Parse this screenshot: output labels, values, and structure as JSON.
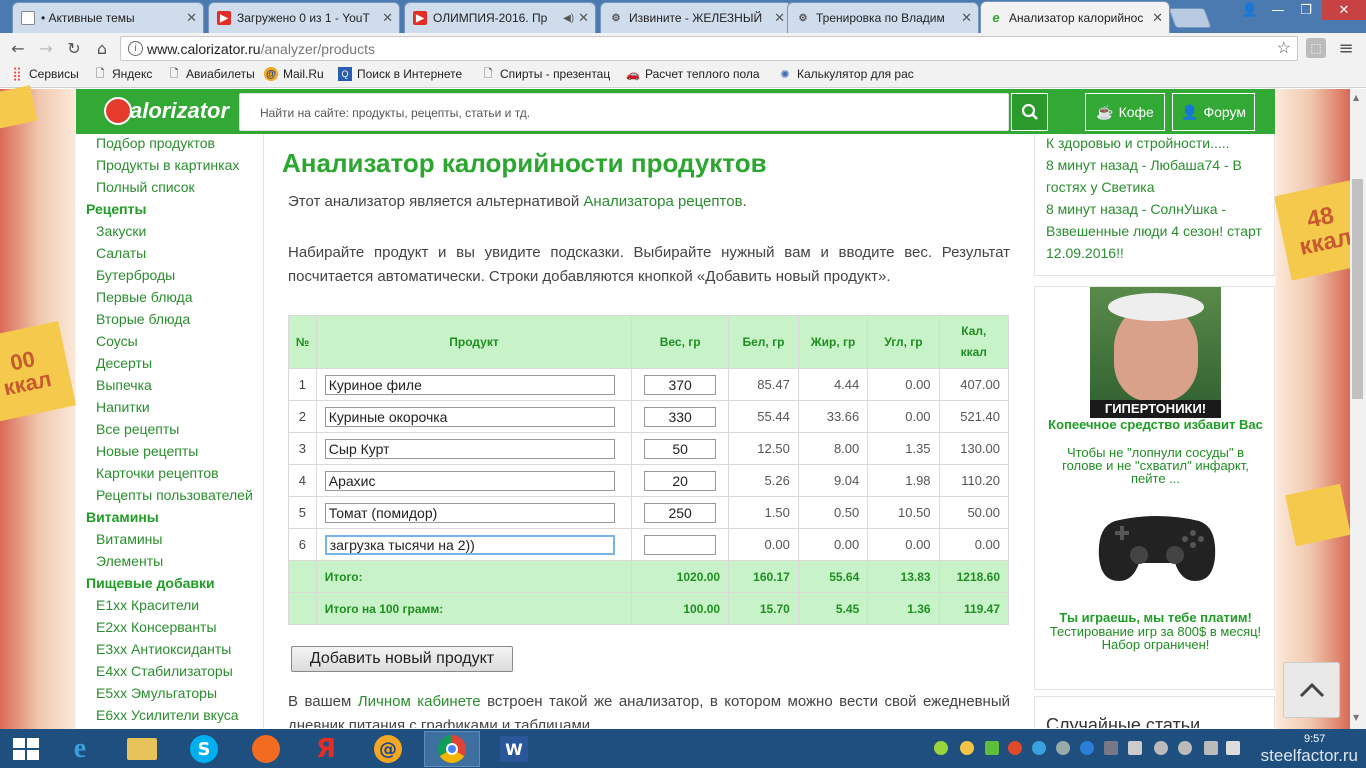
{
  "browser": {
    "tabs": [
      {
        "title": "• Активные темы",
        "icon": "doc-icon",
        "color": "#ffffff"
      },
      {
        "title": "Загружено 0 из 1 - YouT",
        "icon": "youtube-icon",
        "color": "#e52d27"
      },
      {
        "title": "ОЛИМПИЯ-2016. Пр",
        "icon": "youtube-icon",
        "color": "#e52d27"
      },
      {
        "title": "Извините - ЖЕЛЕЗНЫЙ",
        "icon": "barbell-icon",
        "color": "#555555"
      },
      {
        "title": "Тренировка по Владим",
        "icon": "barbell-icon",
        "color": "#555555"
      },
      {
        "title": "Анализатор калорийнос",
        "icon": "calorizator-icon",
        "color": "#2ba62f"
      }
    ],
    "url_domain": "www.calorizator.ru",
    "url_path": "/analyzer/products",
    "bookmarks": [
      {
        "label": "Сервисы",
        "icon": "apps-icon"
      },
      {
        "label": "Яндекс",
        "icon": "doc-icon"
      },
      {
        "label": "Авиабилеты",
        "icon": "doc-icon"
      },
      {
        "label": "Mail.Ru",
        "icon": "mailru-icon"
      },
      {
        "label": "Поиск в Интернете",
        "icon": "search-icon"
      },
      {
        "label": "Спирты - презентац",
        "icon": "doc-icon"
      },
      {
        "label": "Расчет теплого пола",
        "icon": "car-icon"
      },
      {
        "label": "Калькулятор для рас",
        "icon": "gear-icon"
      }
    ]
  },
  "site": {
    "logo_text": "alorizator",
    "search_placeholder": "Найти на сайте: продукты, рецепты, статьи и тд.",
    "coffee_label": "Кофе",
    "forum_label": "Форум"
  },
  "nav": [
    {
      "label": "Подбор продуктов",
      "header": false
    },
    {
      "label": "Продукты в картинках",
      "header": false
    },
    {
      "label": "Полный список",
      "header": false
    },
    {
      "label": "Рецепты",
      "header": true
    },
    {
      "label": "Закуски",
      "header": false
    },
    {
      "label": "Салаты",
      "header": false
    },
    {
      "label": "Бутерброды",
      "header": false
    },
    {
      "label": "Первые блюда",
      "header": false
    },
    {
      "label": "Вторые блюда",
      "header": false
    },
    {
      "label": "Соусы",
      "header": false
    },
    {
      "label": "Десерты",
      "header": false
    },
    {
      "label": "Выпечка",
      "header": false
    },
    {
      "label": "Напитки",
      "header": false
    },
    {
      "label": "Все рецепты",
      "header": false
    },
    {
      "label": "Новые рецепты",
      "header": false
    },
    {
      "label": "Карточки рецептов",
      "header": false
    },
    {
      "label": "Рецепты пользователей",
      "header": false
    },
    {
      "label": "Витамины",
      "header": true
    },
    {
      "label": "Витамины",
      "header": false
    },
    {
      "label": "Элементы",
      "header": false
    },
    {
      "label": "Пищевые добавки",
      "header": true
    },
    {
      "label": "E1xx Красители",
      "header": false
    },
    {
      "label": "E2xx Консерванты",
      "header": false
    },
    {
      "label": "E3xx Антиоксиданты",
      "header": false
    },
    {
      "label": "E4xx Стабилизаторы",
      "header": false
    },
    {
      "label": "E5xx Эмульгаторы",
      "header": false
    },
    {
      "label": "E6xx Усилители вкуса",
      "header": false
    }
  ],
  "main": {
    "title": "Анализатор калорийности продуктов",
    "intro_before": "Этот анализатор является альтернативой ",
    "intro_link": "Анализатора рецептов",
    "intro_after": ".",
    "instructions": "Набирайте продукт и вы увидите подсказки. Выбирайте нужный вам и вводите вес. Результат посчитается автоматически. Строки добавляются кнопкой «Добавить новый продукт».",
    "table": {
      "headers": [
        "№",
        "Продукт",
        "Вес, гр",
        "Бел, гр",
        "Жир, гр",
        "Угл, гр",
        "Кал, ккал"
      ],
      "rows": [
        {
          "n": "1",
          "product": "Куриное филе",
          "weight": "370",
          "protein": "85.47",
          "fat": "4.44",
          "carbs": "0.00",
          "kcal": "407.00"
        },
        {
          "n": "2",
          "product": "Куриные окорочка",
          "weight": "330",
          "protein": "55.44",
          "fat": "33.66",
          "carbs": "0.00",
          "kcal": "521.40"
        },
        {
          "n": "3",
          "product": "Сыр Курт",
          "weight": "50",
          "protein": "12.50",
          "fat": "8.00",
          "carbs": "1.35",
          "kcal": "130.00"
        },
        {
          "n": "4",
          "product": "Арахис",
          "weight": "20",
          "protein": "5.26",
          "fat": "9.04",
          "carbs": "1.98",
          "kcal": "110.20"
        },
        {
          "n": "5",
          "product": "Томат (помидор)",
          "weight": "250",
          "protein": "1.50",
          "fat": "0.50",
          "carbs": "10.50",
          "kcal": "50.00"
        },
        {
          "n": "6",
          "product": "загрузка тысячи на 2))",
          "weight": "",
          "protein": "0.00",
          "fat": "0.00",
          "carbs": "0.00",
          "kcal": "0.00"
        }
      ],
      "total": {
        "label": "Итого:",
        "weight": "1020.00",
        "protein": "160.17",
        "fat": "55.64",
        "carbs": "13.83",
        "kcal": "1218.60"
      },
      "per100": {
        "label": "Итого на 100 грамм:",
        "weight": "100.00",
        "protein": "15.70",
        "fat": "5.45",
        "carbs": "1.36",
        "kcal": "119.47"
      }
    },
    "add_button": "Добавить новый продукт",
    "footer_before": "В вашем ",
    "footer_link": "Личном кабинете",
    "footer_after": " встроен такой же анализатор, в котором можно вести свой ежедневный дневник питания с графиками и таблицами."
  },
  "right": {
    "activity": [
      "К здоровью и стройности.....",
      "8 минут назад - Любаша74 - В",
      "гостях у Светика",
      "8 минут назад - СолнУшка -",
      "Взвешенные люди 4 сезон! старт",
      "12.09.2016!!"
    ],
    "ad1_caption": "ГИПЕРТОНИКИ!",
    "ad1_title": "Копеечное средство избавит Вас",
    "ad1_text": "Чтобы не \"лопнули сосуды\" в голове и не \"схватил\" инфаркт, пейте ...",
    "ad2_title": "Ты играешь, мы тебе платим!",
    "ad2_text": "Тестирование игр за 800$ в месяц! Набор ограничен!",
    "random_title": "Случайные статьи"
  },
  "decor": {
    "sticker_left_top": "00",
    "sticker_left_bottom": "ккал",
    "sticker_right_top": "48",
    "sticker_right_bottom": "ккал"
  },
  "taskbar": {
    "clock": "9:57",
    "watermark": "steelfactor.ru"
  },
  "colors": {
    "brand": "#31a934",
    "taskbar": "#1e4f7e",
    "table_header": "#c8f2c8"
  }
}
